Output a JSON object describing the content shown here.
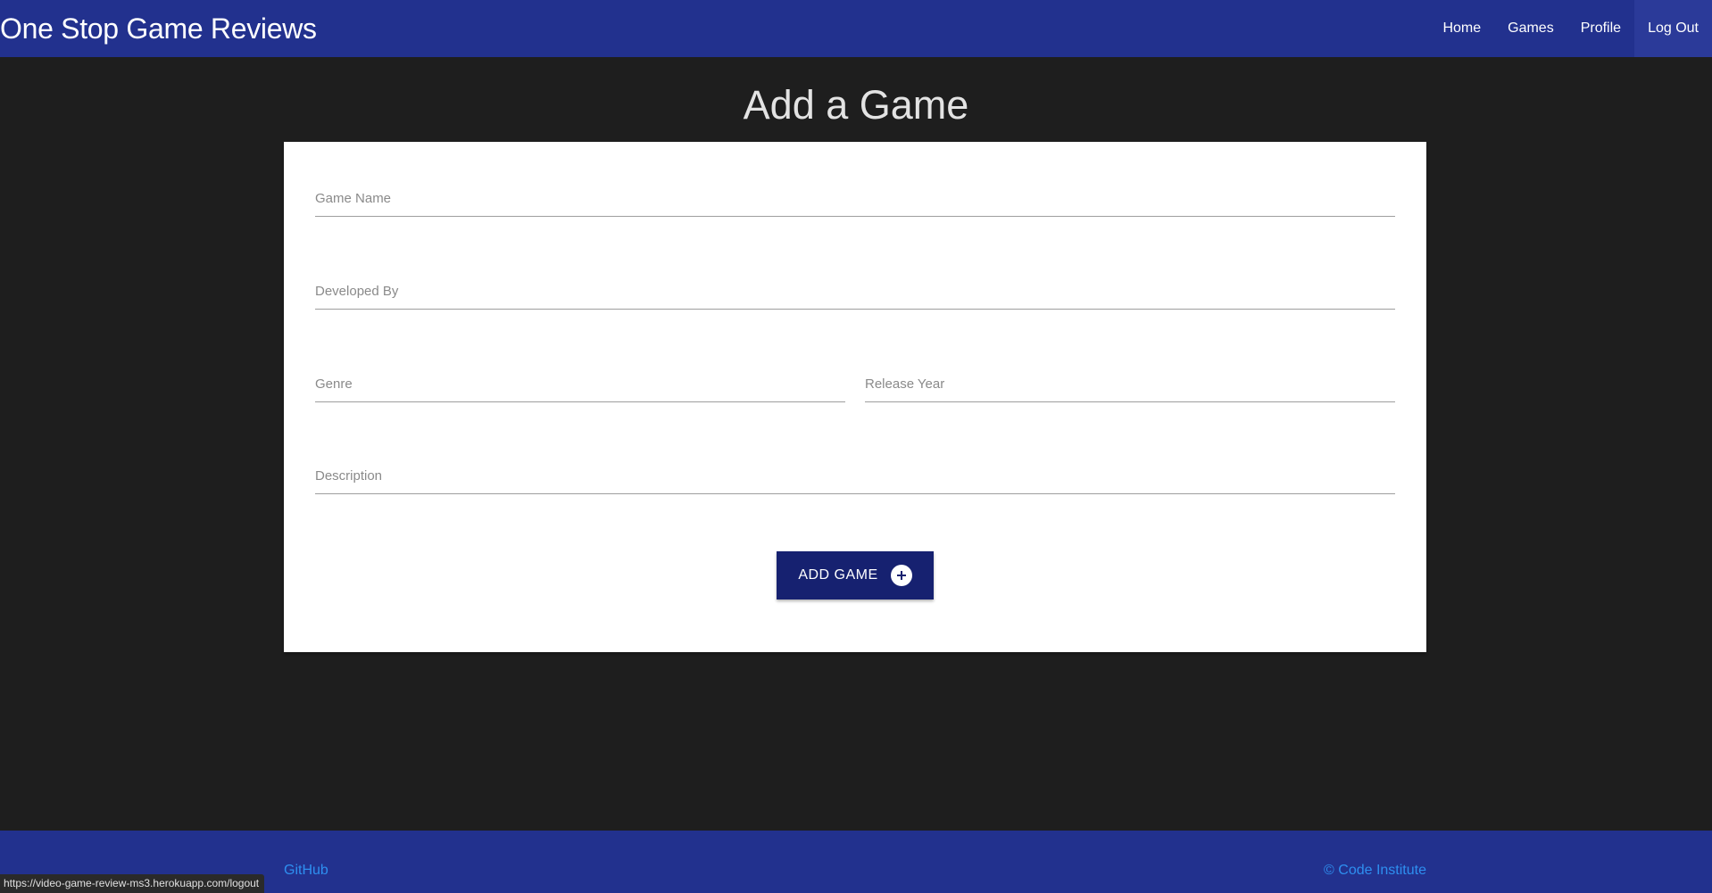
{
  "navbar": {
    "brand": "One Stop Game Reviews",
    "links": [
      {
        "label": "Home"
      },
      {
        "label": "Games"
      },
      {
        "label": "Profile"
      },
      {
        "label": "Log Out"
      }
    ]
  },
  "page": {
    "title": "Add a Game"
  },
  "form": {
    "game_name": {
      "placeholder": "Game Name",
      "value": ""
    },
    "developed_by": {
      "placeholder": "Developed By",
      "value": ""
    },
    "genre": {
      "placeholder": "Genre",
      "value": ""
    },
    "release_year": {
      "placeholder": "Release Year",
      "value": ""
    },
    "description": {
      "placeholder": "Description",
      "value": ""
    },
    "submit_label": "ADD GAME",
    "submit_icon": "plus-circle-icon"
  },
  "footer": {
    "github": "GitHub",
    "copyright": "© Code Institute"
  },
  "status_bar": {
    "url": "https://video-game-review-ms3.herokuapp.com/logout"
  },
  "colors": {
    "navbar": "#22318e",
    "background": "#1e1e1e",
    "button": "#162170",
    "footer_link": "#2e8ff0"
  }
}
